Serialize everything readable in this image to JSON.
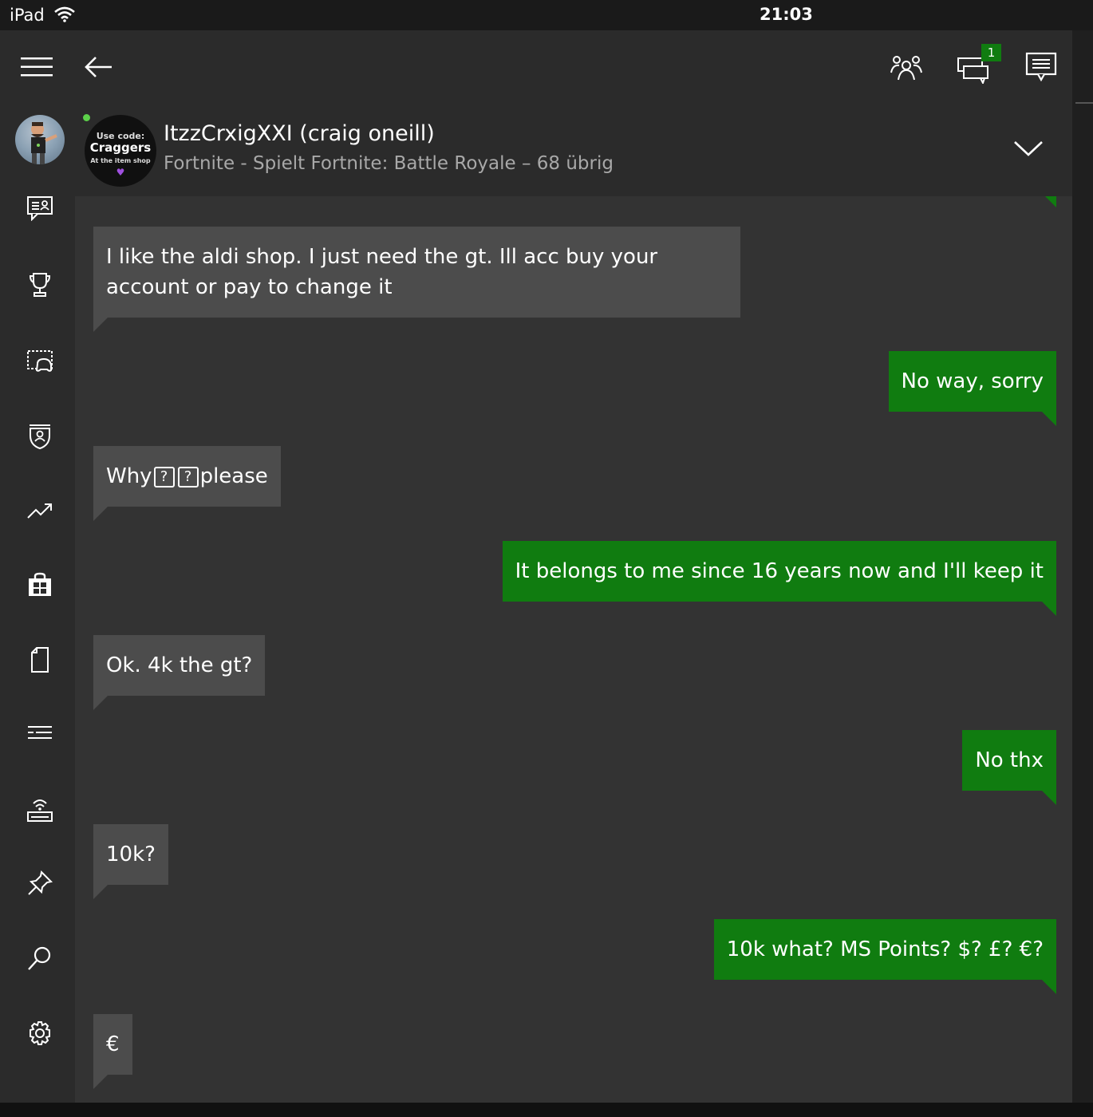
{
  "status_bar": {
    "device": "iPad",
    "time": "21:03"
  },
  "topbar": {
    "badge_count": "1"
  },
  "contact": {
    "pic_line1": "Use code:",
    "pic_line2": "Craggers",
    "pic_line3": "At the item shop",
    "name": "ItzzCrxigXXI (craig oneill)",
    "status": "Fortnite - Spielt Fortnite: Battle Royale – 68 übrig"
  },
  "messages": [
    {
      "direction": "in",
      "text": "I like the aldi shop. I just need the gt. Ill acc buy your account or pay to change it"
    },
    {
      "direction": "out",
      "text": "No way, sorry"
    },
    {
      "direction": "in",
      "text_a": "Why",
      "text_b": "please",
      "unknown_glyph": "?"
    },
    {
      "direction": "out",
      "text": "It belongs to me since 16 years now and I'll keep it"
    },
    {
      "direction": "in",
      "text": "Ok. 4k the gt?"
    },
    {
      "direction": "out",
      "text": "No thx"
    },
    {
      "direction": "in",
      "text": "10k?"
    },
    {
      "direction": "out",
      "text": "10k what? MS Points? $? £? €?"
    },
    {
      "direction": "in",
      "text": "€"
    }
  ],
  "colors": {
    "accent": "#107c10",
    "incoming_bubble": "#4c4c4c",
    "background": "#333333",
    "chrome": "#2b2b2b"
  }
}
